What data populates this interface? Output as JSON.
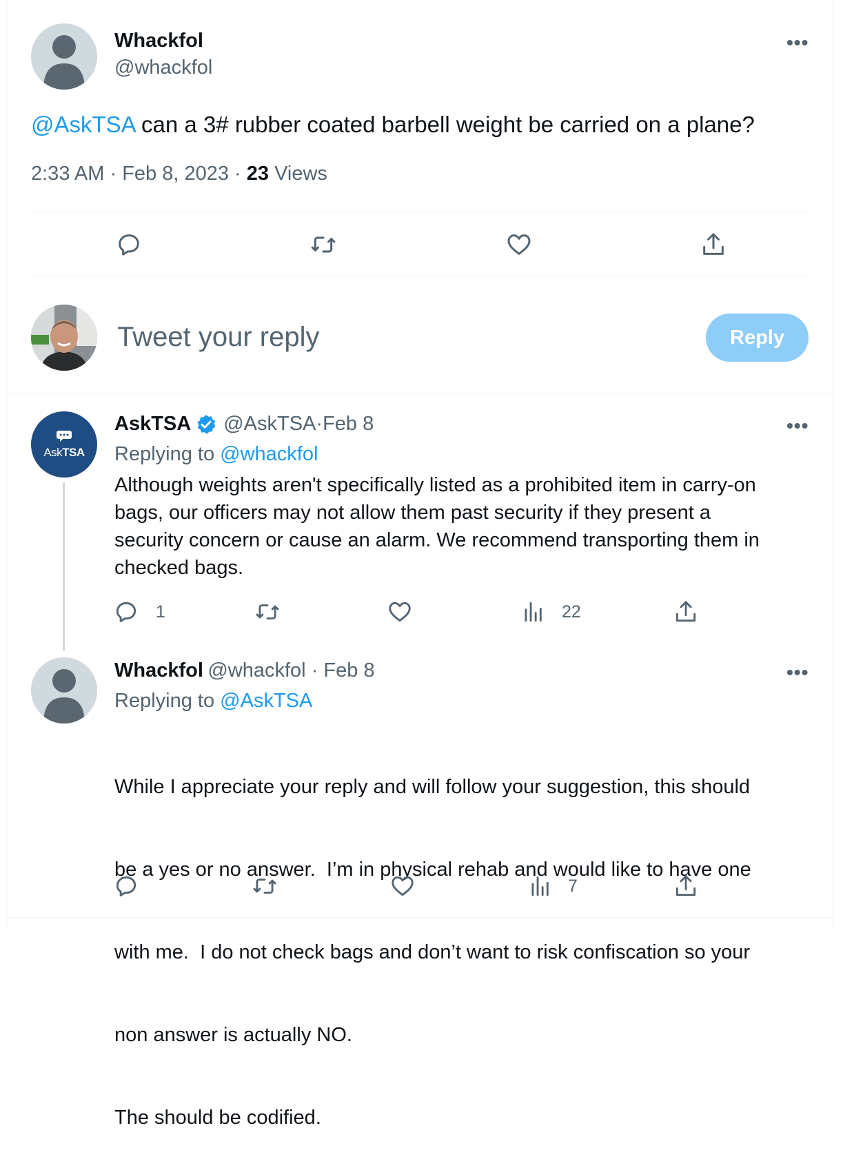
{
  "main_tweet": {
    "display_name": "Whackfol",
    "handle": "@whackfol",
    "mention": "@AskTSA",
    "text": " can a 3# rubber coated barbell weight be carried on a plane?",
    "time": "2:33 AM",
    "sep1": " · ",
    "date": "Feb 8, 2023",
    "sep2": " · ",
    "views_count": "23",
    "views_label": " Views",
    "more": "•••"
  },
  "composer": {
    "placeholder": "Tweet your reply",
    "button_label": "Reply"
  },
  "replies": [
    {
      "display_name": "AskTSA",
      "avatar_text_1": "Ask",
      "avatar_text_2": "TSA",
      "handle": "@AskTSA",
      "dot": " · ",
      "date": "Feb 8",
      "replying_to_label": "Replying to ",
      "replying_to_handle": "@whackfol",
      "text_lines": [
        "Although weights aren't specifically listed as a prohibited item in carry-on",
        "bags, our officers may not allow them past security if they present a",
        "security concern or cause an alarm. We recommend transporting them in",
        "checked bags."
      ],
      "reply_count": "1",
      "views_count": "22",
      "more": "•••"
    },
    {
      "display_name": "Whackfol",
      "handle": "@whackfol",
      "dot": " · ",
      "date": "Feb 8",
      "replying_to_label": "Replying to ",
      "replying_to_handle": "@AskTSA",
      "text_lines": [
        "While I appreciate your reply and will follow your suggestion, this should",
        "be a yes or no answer.  I’m in physical rehab and would like to have one",
        "with me.  I do not check bags and don’t want to risk confiscation so your",
        "non answer is actually NO.",
        "The should be codified."
      ],
      "views_count": "7",
      "more": "•••"
    }
  ],
  "colors": {
    "link": "#1d9bf0",
    "muted": "#536471",
    "verified": "#1d9bf0",
    "reply_button": "#8ecdf7",
    "asktsa_avatar": "#1f4c82"
  }
}
